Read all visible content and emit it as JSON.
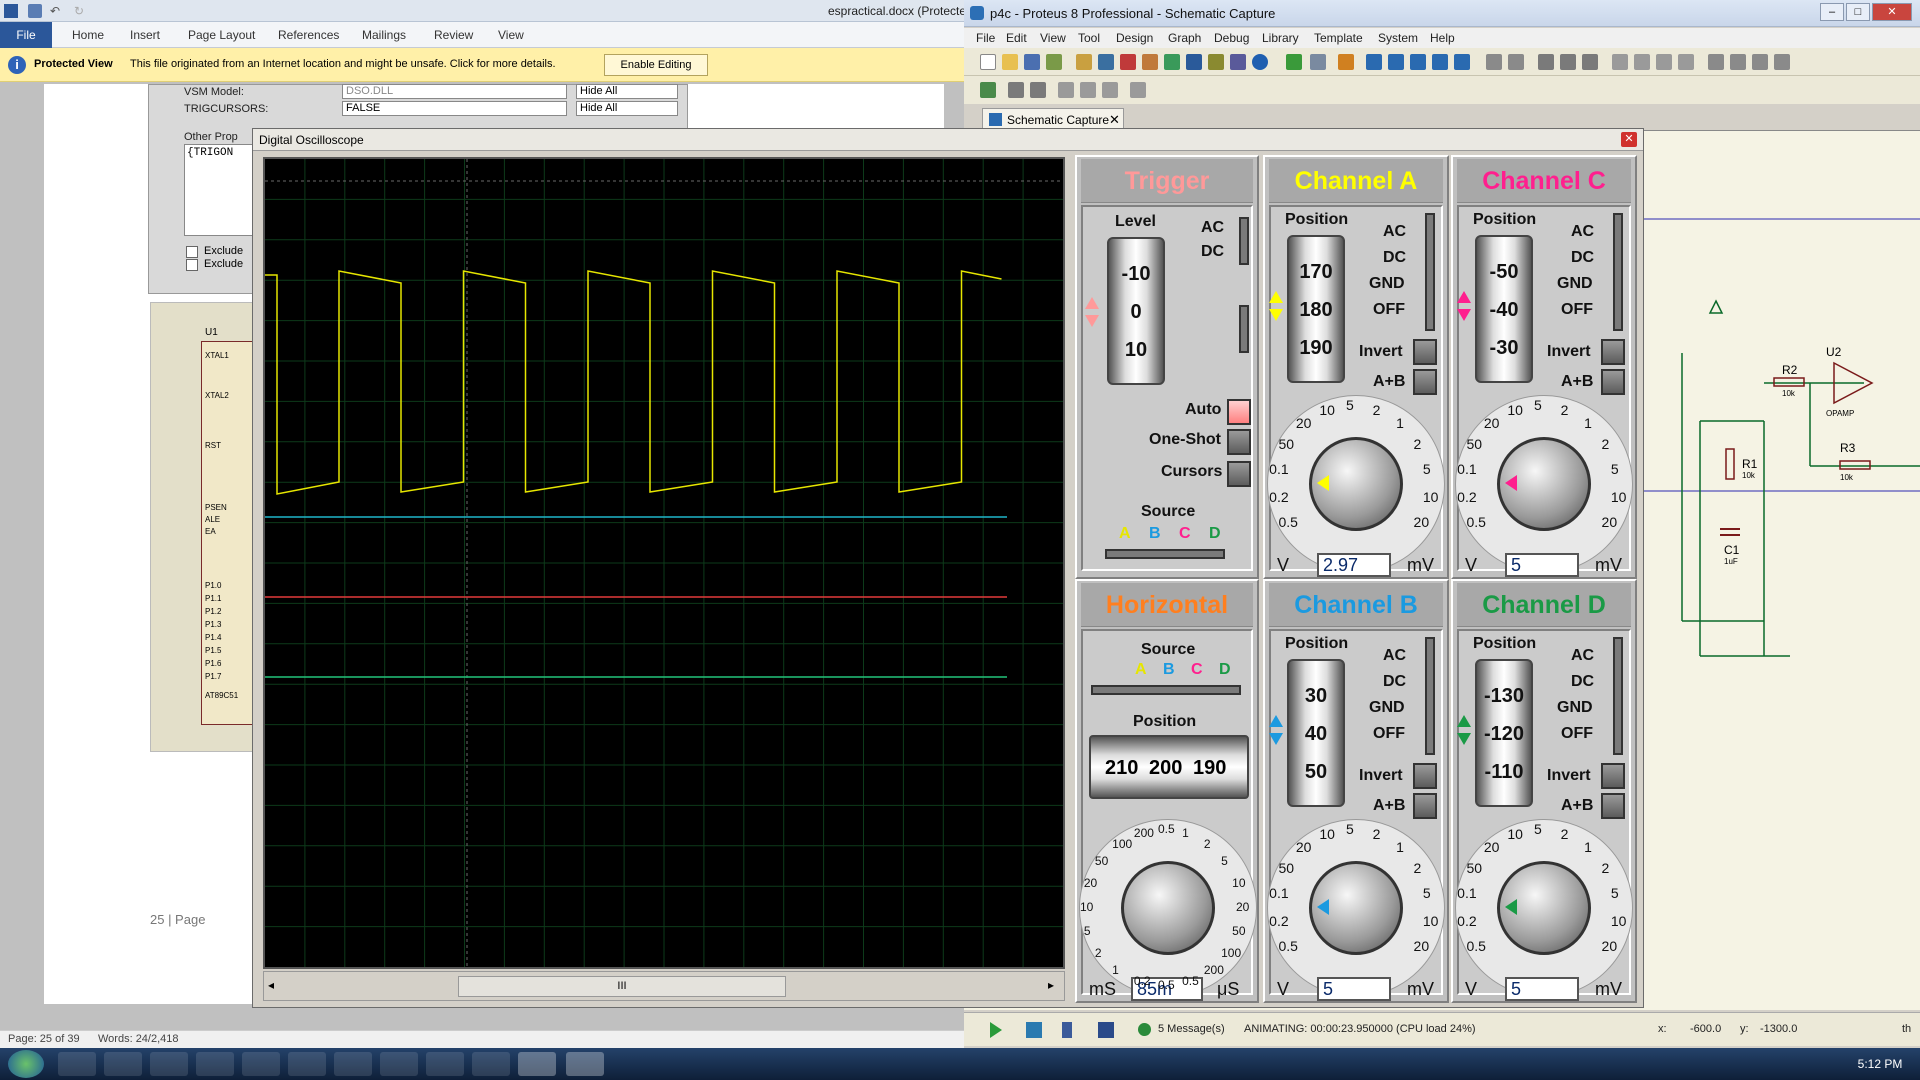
{
  "word": {
    "title": "espractical.docx (Protecte",
    "file_tab": "File",
    "tabs": [
      "Home",
      "Insert",
      "Page Layout",
      "References",
      "Mailings",
      "Review",
      "View"
    ],
    "protected_label": "Protected View",
    "protected_message": "This file originated from an Internet location and might be unsafe. Click for more details.",
    "enable_button": "Enable Editing",
    "props": {
      "vsm_label": "VSM Model:",
      "vsm_value": "DSO.DLL",
      "vsm_hide": "Hide All",
      "trig_label": "TRIGCURSORS:",
      "trig_value": "FALSE",
      "trig_hide": "Hide All",
      "other_label": "Other Prop",
      "other_value": "{TRIGON",
      "exclude": "Exclude"
    },
    "schematic": {
      "u1": "U1",
      "chip": "AT89C51",
      "pins": [
        "XTAL1",
        "XTAL2",
        "RST",
        "PSEN",
        "ALE",
        "EA",
        "P1.0",
        "P1.1",
        "P1.2",
        "P1.3",
        "P1.4",
        "P1.5",
        "P1.6",
        "P1.7"
      ]
    },
    "page_number": "25 | Page",
    "status_page": "Page: 25 of 39",
    "status_words": "Words: 24/2,418"
  },
  "proteus": {
    "title": "p4c - Proteus 8 Professional - Schematic Capture",
    "menu": [
      "File",
      "Edit",
      "View",
      "Tool",
      "Design",
      "Graph",
      "Debug",
      "Library",
      "Template",
      "System",
      "Help"
    ],
    "tab": "Schematic Capture",
    "messages": "5 Message(s)",
    "animating": "ANIMATING: 00:00:23.950000 (CPU load 24%)",
    "coord_x_label": "x:",
    "coord_x": "-600.0",
    "coord_y_label": "y:",
    "coord_y": "-1300.0",
    "th": "th",
    "components": {
      "r1": "R1",
      "r1v": "10k",
      "r2": "R2",
      "r2v": "10k",
      "r3": "R3",
      "r3v": "10k",
      "u2": "U2",
      "opamp": "OPAMP",
      "c1": "C1",
      "c1v": "1uF"
    }
  },
  "oscilloscope": {
    "title": "Digital Oscilloscope",
    "trigger": {
      "header": "Trigger",
      "level": "Level",
      "ticks": [
        "-10",
        "0",
        "10"
      ],
      "ac": "AC",
      "dc": "DC",
      "auto": "Auto",
      "oneshot": "One-Shot",
      "cursors": "Cursors",
      "source": "Source",
      "sources": [
        "A",
        "B",
        "C",
        "D"
      ]
    },
    "horizontal": {
      "header": "Horizontal",
      "source": "Source",
      "sources": [
        "A",
        "B",
        "C",
        "D"
      ],
      "position": "Position",
      "ticks": [
        "210",
        "200",
        "190"
      ],
      "value": "85m",
      "unit_left": "mS",
      "unit_right": "μS",
      "scale": [
        "0.5",
        "0.2",
        "1",
        "2",
        "5",
        "10",
        "20",
        "50",
        "100",
        "200",
        "0.5",
        "1",
        "2",
        "5",
        "10",
        "20",
        "50",
        "100",
        "200",
        "0.5"
      ]
    },
    "channels": [
      {
        "id": "a",
        "header": "Channel A",
        "color": "#ffff00",
        "ticks": [
          "170",
          "180",
          "190"
        ],
        "value": "2.97",
        "invert": "Invert",
        "extra": "A+B",
        "coupling": [
          "AC",
          "DC",
          "GND",
          "OFF"
        ],
        "position": "Position",
        "v": "V",
        "mv": "mV"
      },
      {
        "id": "c",
        "header": "Channel C",
        "color": "#ff1f8e",
        "ticks": [
          "-50",
          "-40",
          "-30"
        ],
        "value": "5",
        "invert": "Invert",
        "extra": "A+B",
        "coupling": [
          "AC",
          "DC",
          "GND",
          "OFF"
        ],
        "position": "Position",
        "v": "V",
        "mv": "mV"
      },
      {
        "id": "b",
        "header": "Channel B",
        "color": "#1b9ae0",
        "ticks": [
          "30",
          "40",
          "50"
        ],
        "value": "5",
        "invert": "Invert",
        "extra": "A+B",
        "coupling": [
          "AC",
          "DC",
          "GND",
          "OFF"
        ],
        "position": "Position",
        "v": "V",
        "mv": "mV"
      },
      {
        "id": "d",
        "header": "Channel D",
        "color": "#1a9a46",
        "ticks": [
          "-130",
          "-120",
          "-110"
        ],
        "value": "5",
        "invert": "Invert",
        "extra": "A+B",
        "coupling": [
          "AC",
          "DC",
          "GND",
          "OFF"
        ],
        "position": "Position",
        "v": "V",
        "mv": "mV"
      }
    ],
    "dial_scale": [
      "0.5",
      "0.2",
      "0.1",
      "50",
      "20",
      "10",
      "5",
      "2",
      "1",
      "2",
      "5",
      "10",
      "20"
    ],
    "trace_colors": {
      "a": "#e6e600",
      "b": "#1fb6c9",
      "c": "#e23b3b",
      "d": "#22c47a"
    },
    "accent_trigger": "#ff9999",
    "accent_horizontal": "#ff7f1f",
    "scroll_thumb": "III"
  },
  "clock": "5:12 PM"
}
